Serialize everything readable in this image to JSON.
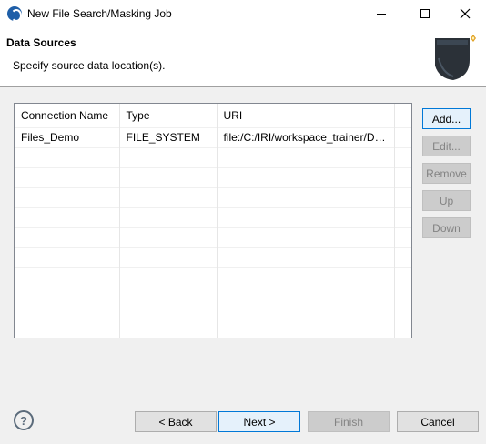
{
  "window": {
    "title": "New File Search/Masking Job"
  },
  "header": {
    "title": "Data Sources",
    "description": "Specify source data location(s)."
  },
  "table": {
    "columns": [
      "Connection Name",
      "Type",
      "URI"
    ],
    "rows": [
      [
        "Files_Demo",
        "FILE_SYSTEM",
        "file:/C:/IRI/workspace_trainer/Da..."
      ]
    ]
  },
  "side_buttons": {
    "add": "Add...",
    "edit": "Edit...",
    "remove": "Remove",
    "up": "Up",
    "down": "Down"
  },
  "footer": {
    "help": "?",
    "back": "< Back",
    "next": "Next >",
    "finish": "Finish",
    "cancel": "Cancel"
  }
}
